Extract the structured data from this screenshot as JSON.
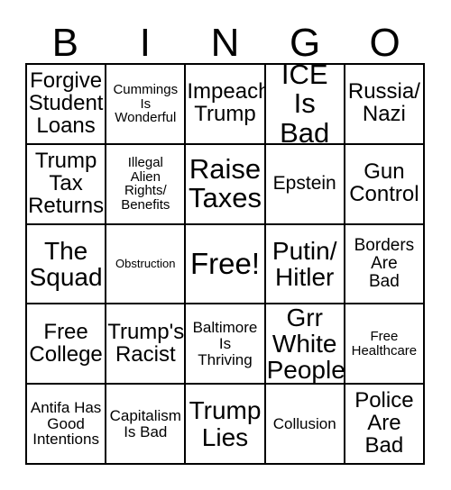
{
  "card": {
    "title_letters": [
      "B",
      "I",
      "N",
      "G",
      "O"
    ],
    "border_color": "#000000",
    "background_color": "#ffffff",
    "text_color": "#000000"
  },
  "grid": {
    "columns": 5,
    "rows": 5,
    "cells": [
      {
        "id": "r1c1",
        "text": "Forgive Student Loans",
        "lines": [
          "Forgive",
          "Student",
          "Loans"
        ],
        "size": "fs-xl"
      },
      {
        "id": "r1c2",
        "text": "Cummings Is Wonderful",
        "lines": [
          "Cummings",
          "Is",
          "Wonderful"
        ],
        "size": "fs-s"
      },
      {
        "id": "r1c3",
        "text": "Impeach Trump",
        "lines": [
          "Impeach",
          "Trump"
        ],
        "size": "fs-xl"
      },
      {
        "id": "r1c4",
        "text": "ICE Is Bad",
        "lines": [
          "ICE Is",
          "Bad"
        ],
        "size": "fs-hu"
      },
      {
        "id": "r1c5",
        "text": "Russia/ Nazi",
        "lines": [
          "Russia/",
          "Nazi"
        ],
        "size": "fs-xl"
      },
      {
        "id": "r2c1",
        "text": "Trump Tax Returns",
        "lines": [
          "Trump",
          "Tax",
          "Returns"
        ],
        "size": "fs-xl"
      },
      {
        "id": "r2c2",
        "text": "Illegal Alien Rights/ Benefits",
        "lines": [
          "Illegal",
          "Alien",
          "Rights/",
          "Benefits"
        ],
        "size": "fs-s"
      },
      {
        "id": "r2c3",
        "text": "Raise Taxes",
        "lines": [
          "Raise",
          "Taxes"
        ],
        "size": "fs-hu"
      },
      {
        "id": "r2c4",
        "text": "Epstein",
        "lines": [
          "Epstein"
        ],
        "size": "fs-l"
      },
      {
        "id": "r2c5",
        "text": "Gun Control",
        "lines": [
          "Gun",
          "Control"
        ],
        "size": "fs-xl"
      },
      {
        "id": "r3c1",
        "text": "The Squad",
        "lines": [
          "The",
          "Squad"
        ],
        "size": "fs-xxl"
      },
      {
        "id": "r3c2",
        "text": "Obstruction",
        "lines": [
          "Obstruction"
        ],
        "size": "fs-xs"
      },
      {
        "id": "r3c3",
        "text": "Free!",
        "lines": [
          "Free!"
        ],
        "size": "fs-free"
      },
      {
        "id": "r3c4",
        "text": "Putin/ Hitler",
        "lines": [
          "Putin/",
          "Hitler"
        ],
        "size": "fs-xxl"
      },
      {
        "id": "r3c5",
        "text": "Borders Are Bad",
        "lines": [
          "Borders",
          "Are",
          "Bad"
        ],
        "size": "fs-ml"
      },
      {
        "id": "r4c1",
        "text": "Free College",
        "lines": [
          "Free",
          "College"
        ],
        "size": "fs-xl"
      },
      {
        "id": "r4c2",
        "text": "Trump's Racist",
        "lines": [
          "Trump's",
          "Racist"
        ],
        "size": "fs-xl"
      },
      {
        "id": "r4c3",
        "text": "Baltimore Is Thriving",
        "lines": [
          "Baltimore",
          "Is",
          "Thriving"
        ],
        "size": "fs-m"
      },
      {
        "id": "r4c4",
        "text": "Grr White People",
        "lines": [
          "Grr",
          "White",
          "People"
        ],
        "size": "fs-xxl"
      },
      {
        "id": "r4c5",
        "text": "Free Healthcare",
        "lines": [
          "Free",
          "Healthcare"
        ],
        "size": "fs-s"
      },
      {
        "id": "r5c1",
        "text": "Antifa Has Good Intentions",
        "lines": [
          "Antifa Has",
          "Good",
          "Intentions"
        ],
        "size": "fs-m"
      },
      {
        "id": "r5c2",
        "text": "Capitalism Is Bad",
        "lines": [
          "Capitalism",
          "Is Bad"
        ],
        "size": "fs-m"
      },
      {
        "id": "r5c3",
        "text": "Trump Lies",
        "lines": [
          "Trump",
          "Lies"
        ],
        "size": "fs-xxl"
      },
      {
        "id": "r5c4",
        "text": "Collusion",
        "lines": [
          "Collusion"
        ],
        "size": "fs-m"
      },
      {
        "id": "r5c5",
        "text": "Police Are Bad",
        "lines": [
          "Police",
          "Are",
          "Bad"
        ],
        "size": "fs-xl"
      }
    ]
  }
}
